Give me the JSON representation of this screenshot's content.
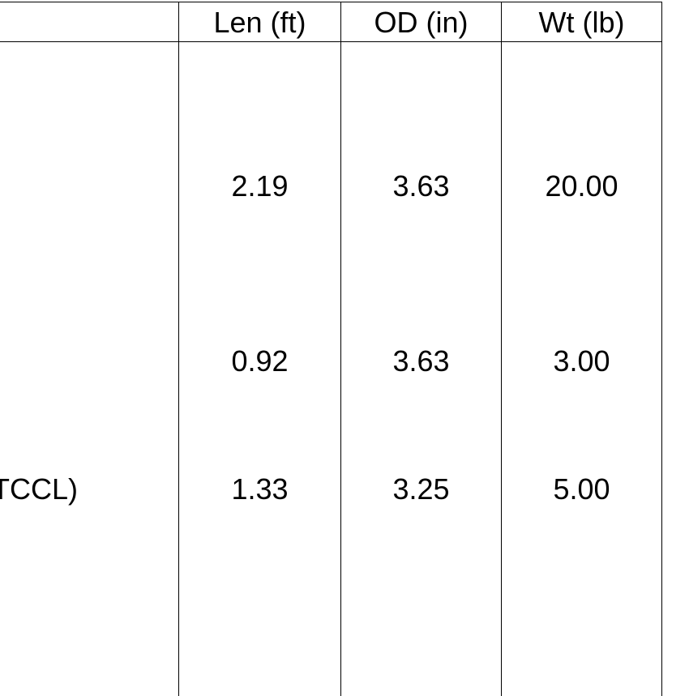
{
  "table": {
    "headers": [
      "Len (ft)",
      "OD (in)",
      "Wt (lb)"
    ],
    "rows": [
      {
        "label": "",
        "values": [
          "2.19",
          "3.63",
          "20.00"
        ]
      },
      {
        "label": "",
        "values": [
          "0.92",
          "3.63",
          "3.00"
        ]
      },
      {
        "label": "TCCL)",
        "values": [
          "1.33",
          "3.25",
          "5.00"
        ]
      }
    ]
  }
}
